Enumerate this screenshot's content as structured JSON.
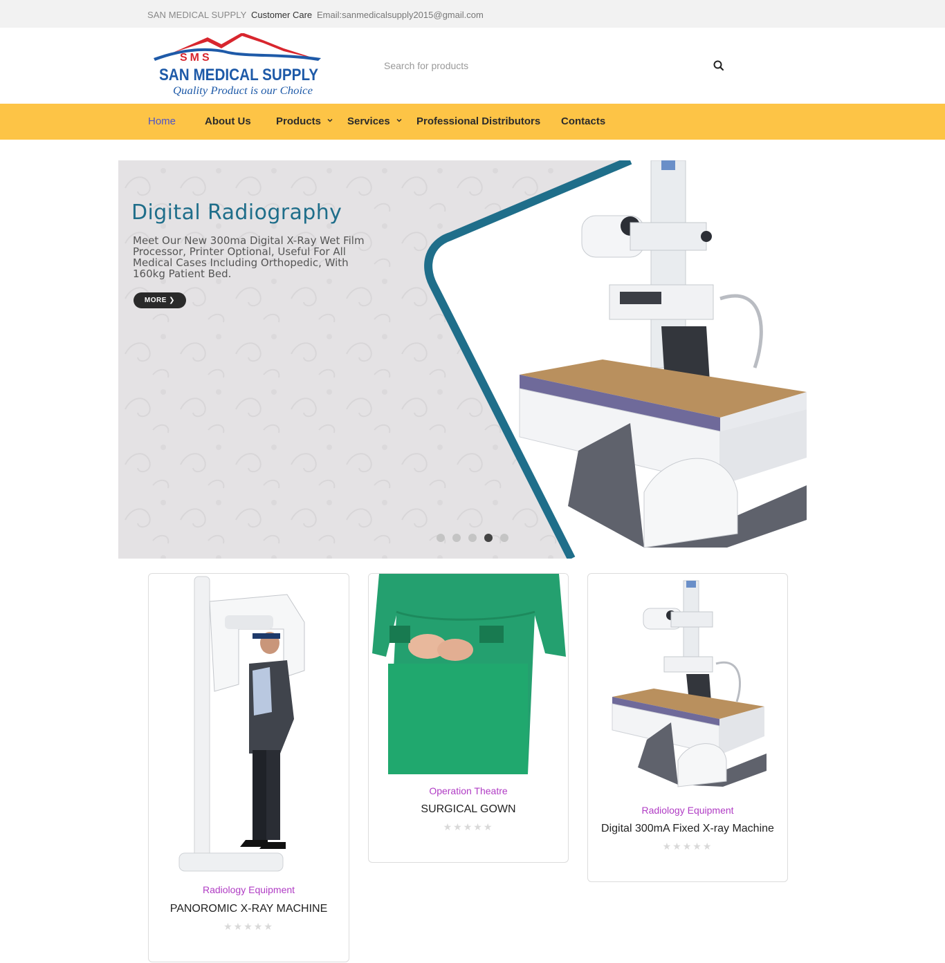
{
  "topbar": {
    "brand": "SAN MEDICAL SUPPLY",
    "customer_care": "Customer Care",
    "email": "Email:sanmedicalsupply2015@gmail.com"
  },
  "logo": {
    "initials": "SMS",
    "name": "SAN MEDICAL SUPPLY",
    "tagline": "Quality Product is our Choice"
  },
  "search": {
    "placeholder": "Search for products",
    "icon": "search-icon"
  },
  "nav": {
    "items": [
      {
        "label": "Home",
        "active": true
      },
      {
        "label": "About Us"
      },
      {
        "label": "Products",
        "dropdown": true
      },
      {
        "label": "Services",
        "dropdown": true
      },
      {
        "label": "Professional Distributors"
      },
      {
        "label": "Contacts"
      }
    ]
  },
  "slider": {
    "title": "Digital Radiography",
    "text": "Meet Our New 300ma Digital X-Ray Wet Film Processor, Printer Optional, Useful For All Medical Cases Including Orthopedic, With 160kg Patient Bed.",
    "button": "MORE ❯",
    "slide_count": 5,
    "active_slide": 4
  },
  "products": [
    {
      "category": "Radiology Equipment",
      "name": "PANOROMIC X-RAY MACHINE",
      "rating": 0,
      "stars": "★★★★★"
    },
    {
      "category": "Operation Theatre",
      "name": "SURGICAL GOWN",
      "rating": 0,
      "stars": "★★★★★"
    },
    {
      "category": "Radiology Equipment",
      "name": "Digital 300mA Fixed X-ray Machine",
      "rating": 0,
      "stars": "★★★★★"
    }
  ],
  "colors": {
    "nav_bg": "#fdc446",
    "nav_active": "#4b53c9",
    "category": "#b03cc4",
    "slider_title": "#1f6e8a",
    "slider_stripe": "#1f6e8a"
  }
}
